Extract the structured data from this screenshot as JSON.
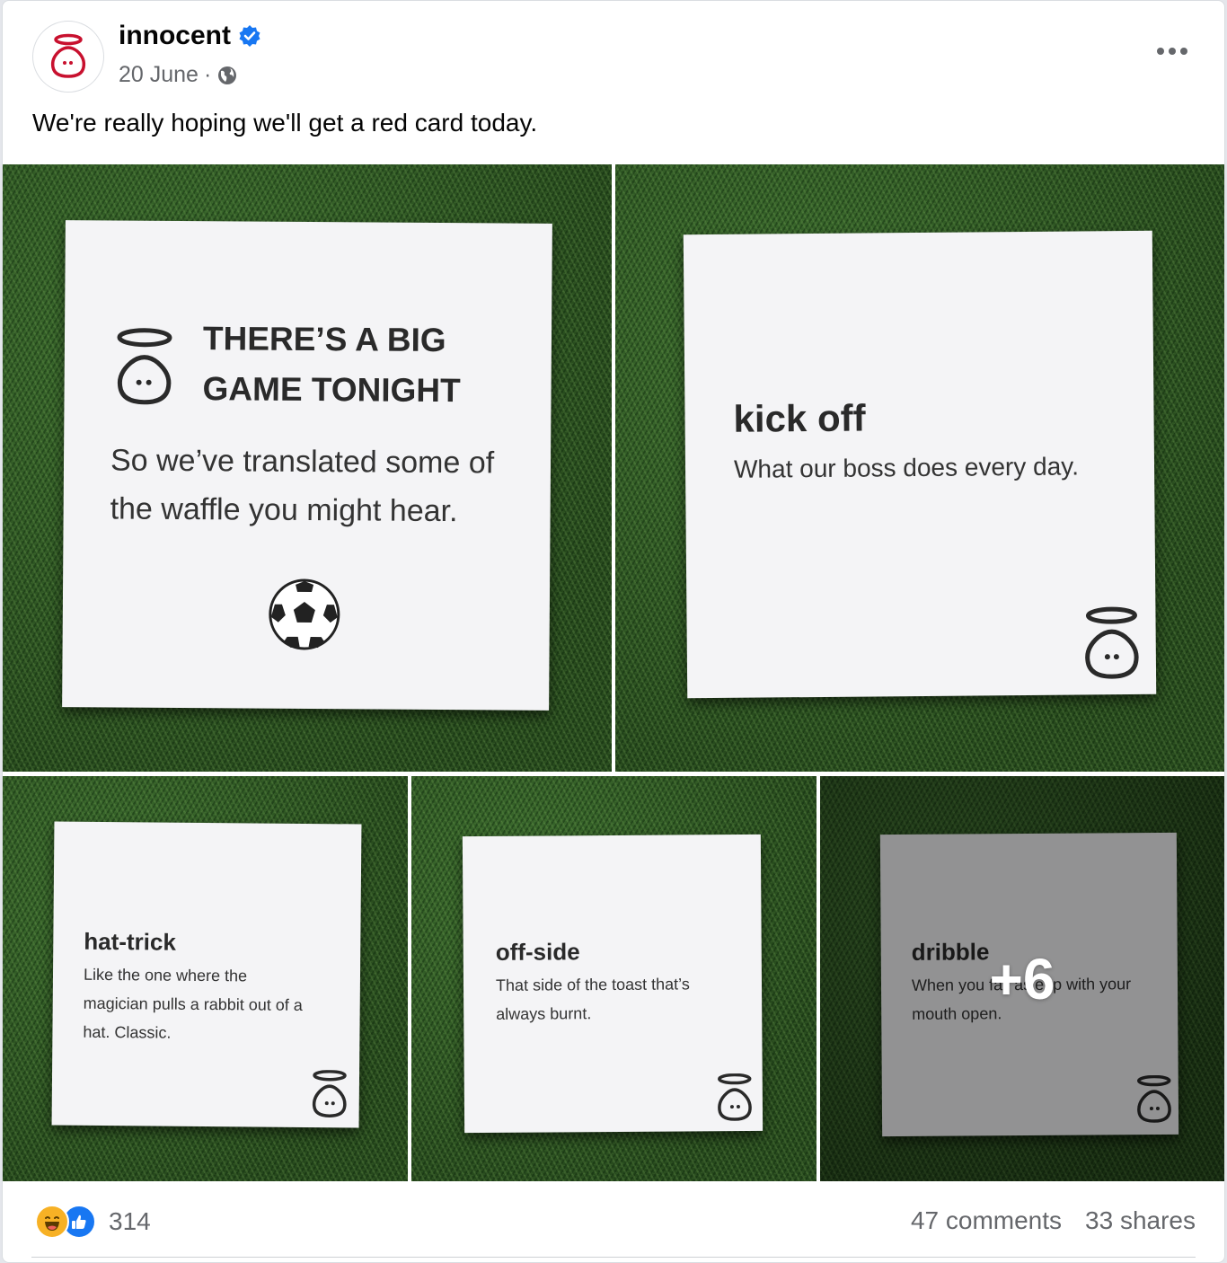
{
  "page": {
    "name": "innocent",
    "date": "20 June",
    "separator": " · "
  },
  "caption": "We're really hoping we'll get a red card today.",
  "icons": {
    "verified": "verified-badge-icon",
    "privacy": "globe-icon",
    "more": "more-options-icon"
  },
  "cards": {
    "c1": {
      "title_line1": "THERE’S A BIG",
      "title_line2": "GAME TONIGHT",
      "body_line1": "So we’ve translated some of",
      "body_line2": "the waffle you might hear."
    },
    "c2": {
      "title": "kick off",
      "body": "What our boss does every day."
    },
    "c3": {
      "title": "hat-trick",
      "body_line1": "Like the one where the",
      "body_line2": "magician pulls a rabbit out of a",
      "body_line3": "hat. Classic."
    },
    "c4": {
      "title": "off-side",
      "body_line1": "That side of the toast that’s",
      "body_line2": "always burnt."
    },
    "c5": {
      "title": "dribble",
      "body_line1": "When you fall asleep with your",
      "body_line2": "mouth open."
    }
  },
  "more_photos": "+6",
  "footer": {
    "reaction_count": "314",
    "comments": "47 comments",
    "shares": "33 shares"
  },
  "colors": {
    "brand_red": "#c8102e",
    "verified_blue": "#1877f2",
    "like_blue": "#1877f2",
    "haha_yellow": "#f7b125",
    "text_secondary": "#65676b"
  }
}
